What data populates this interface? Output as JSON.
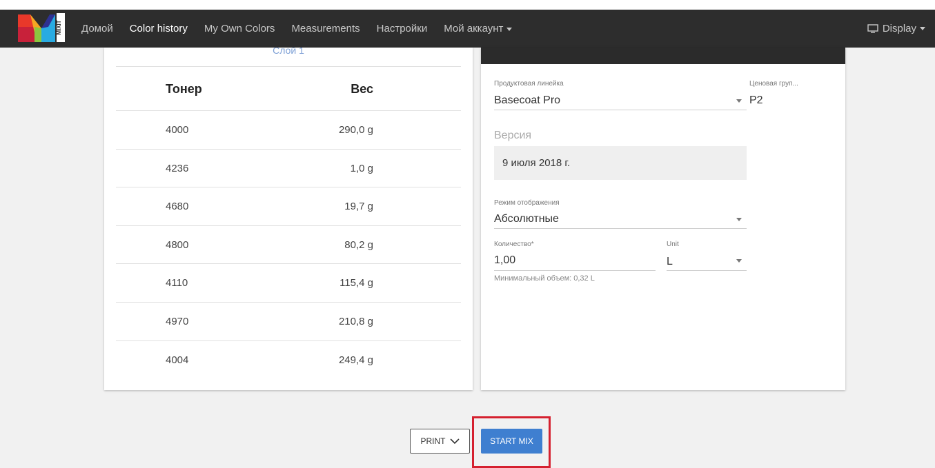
{
  "nav": {
    "logo_text": "MIXIT",
    "items": [
      {
        "label": "Домой",
        "active": false
      },
      {
        "label": "Color history",
        "active": true
      },
      {
        "label": "My Own Colors",
        "active": false
      },
      {
        "label": "Measurements",
        "active": false
      },
      {
        "label": "Настройки",
        "active": false
      },
      {
        "label": "Мой аккаунт",
        "active": false
      }
    ],
    "display_label": "Display"
  },
  "formula": {
    "layer_label": "Слой 1",
    "columns": [
      "Тонер",
      "Вес"
    ],
    "rows": [
      {
        "toner": "4000",
        "weight": "290,0 g"
      },
      {
        "toner": "4236",
        "weight": "1,0 g"
      },
      {
        "toner": "4680",
        "weight": "19,7 g"
      },
      {
        "toner": "4800",
        "weight": "80,2 g"
      },
      {
        "toner": "4110",
        "weight": "115,4 g"
      },
      {
        "toner": "4970",
        "weight": "210,8 g"
      },
      {
        "toner": "4004",
        "weight": "249,4 g"
      }
    ]
  },
  "settings": {
    "product_line_label": "Продуктовая линейка",
    "product_line_value": "Basecoat Pro",
    "price_group_label": "Ценовая груп...",
    "price_group_value": "P2",
    "version_title": "Версия",
    "version_value": "9 июля 2018 г.",
    "display_mode_label": "Режим отображения",
    "display_mode_value": "Абсолютные",
    "quantity_label": "Количество*",
    "quantity_value": "1,00",
    "unit_label": "Unit",
    "unit_value": "L",
    "min_volume_hint": "Минимальный объем: 0,32 L"
  },
  "actions": {
    "print_label": "PRINT",
    "start_mix_label": "START MIX"
  },
  "colors": {
    "navbar_bg": "#2d2d2d",
    "accent_blue": "#3f7fd0",
    "highlight_red": "#d5202f"
  }
}
